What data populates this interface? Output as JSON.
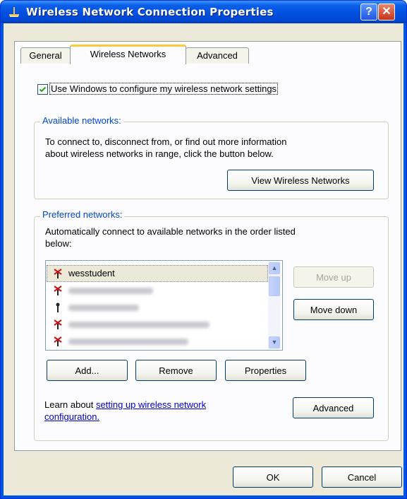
{
  "window": {
    "title": "Wireless Network Connection Properties",
    "help_label": "?",
    "close_label": "✕"
  },
  "tabs": [
    {
      "label": "General",
      "active": false
    },
    {
      "label": "Wireless Networks",
      "active": true
    },
    {
      "label": "Advanced",
      "active": false
    }
  ],
  "use_windows": {
    "checked": true,
    "label": "Use Windows to configure my wireless network settings"
  },
  "available": {
    "title": "Available networks:",
    "description_line1": "To connect to, disconnect from, or find out more information",
    "description_line2": "about wireless networks in range, click the button below.",
    "view_button": "View Wireless Networks"
  },
  "preferred": {
    "title": "Preferred networks:",
    "description_line1": "Automatically connect to available networks in the order listed",
    "description_line2": "below:",
    "networks": [
      {
        "name": "wesstudent",
        "selected": true,
        "status": "unavailable"
      },
      {
        "name": "",
        "selected": false,
        "status": "unavailable"
      },
      {
        "name": "",
        "selected": false,
        "status": "available"
      },
      {
        "name": "",
        "selected": false,
        "status": "unavailable"
      },
      {
        "name": "",
        "selected": false,
        "status": "unavailable"
      }
    ],
    "move_up": "Move up",
    "move_down": "Move down",
    "add": "Add...",
    "remove": "Remove",
    "properties": "Properties"
  },
  "learn": {
    "prefix": "Learn about",
    "link_line1": "setting up wireless network",
    "link_line2": "configuration.",
    "advanced_button": "Advanced"
  },
  "footer": {
    "ok": "OK",
    "cancel": "Cancel"
  },
  "colors": {
    "title_bar": "#0054e3",
    "tab_highlight": "#ffc83c",
    "group_title": "#0046d5",
    "link": "#0000cc"
  }
}
